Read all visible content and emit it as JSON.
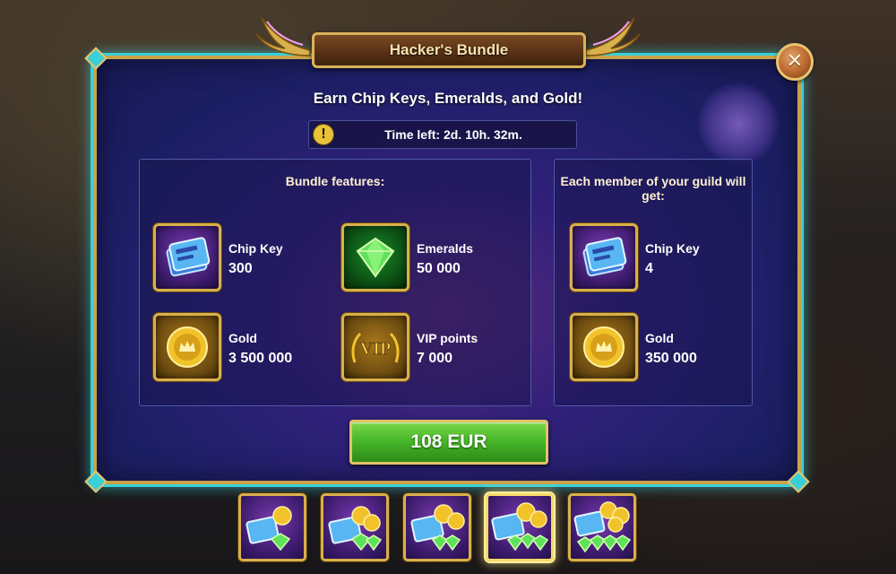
{
  "dialog": {
    "title": "Hacker's Bundle",
    "subtitle": "Earn Chip Keys, Emeralds, and Gold!",
    "timer_text": "Time left: 2d. 10h. 32m.",
    "close_icon": "close-icon"
  },
  "features": {
    "title": "Bundle features:",
    "items": [
      {
        "label": "Chip Key",
        "value": "300",
        "icon": "chip-key-icon"
      },
      {
        "label": "Emeralds",
        "value": "50 000",
        "icon": "emerald-icon"
      },
      {
        "label": "Gold",
        "value": "3 500 000",
        "icon": "gold-coin-icon"
      },
      {
        "label": "VIP points",
        "value": "7 000",
        "icon": "vip-icon"
      }
    ]
  },
  "guild": {
    "title": "Each member of your guild will get:",
    "items": [
      {
        "label": "Chip Key",
        "value": "4",
        "icon": "chip-key-icon"
      },
      {
        "label": "Gold",
        "value": "350 000",
        "icon": "gold-coin-icon"
      }
    ]
  },
  "buy": {
    "price": "108 EUR"
  },
  "bundle_tabs": {
    "count": 5,
    "active_index": 3
  },
  "colors": {
    "frame_gold": "#c9a24a",
    "frame_glow": "#3ad0d8",
    "buy_green": "#48b82a",
    "panel_bg": "#1d1f66"
  }
}
